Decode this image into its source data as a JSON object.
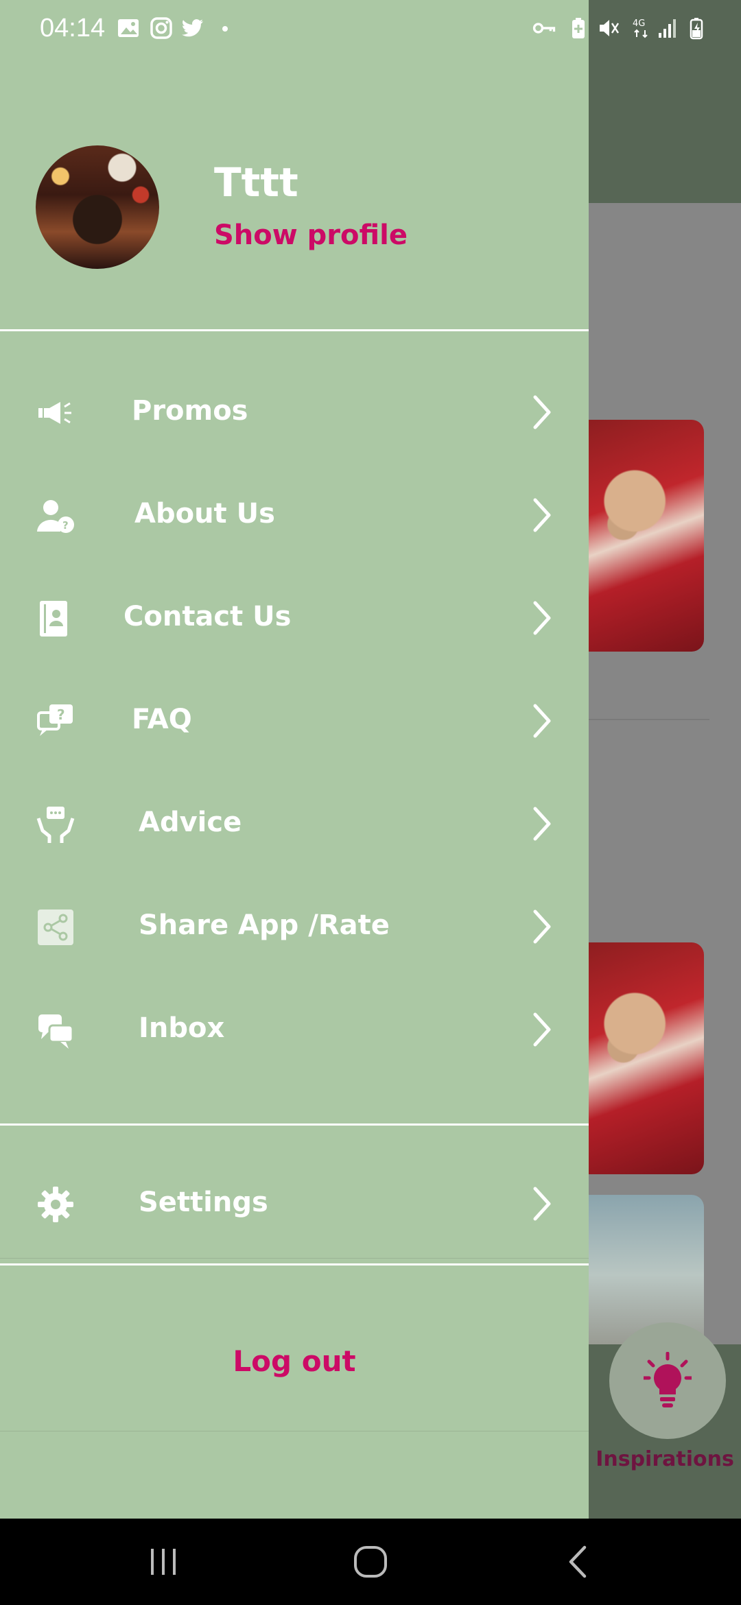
{
  "status_bar": {
    "time": "04:14",
    "left_icons": [
      "image-icon",
      "instagram-icon",
      "twitter-icon",
      "dot-icon"
    ],
    "right_icons": [
      "vpn-key-icon",
      "battery-saver-icon",
      "mute-icon",
      "network-4g-icon",
      "signal-icon",
      "battery-charging-icon"
    ],
    "network_label": "4G"
  },
  "drawer": {
    "profile": {
      "name": "Tttt",
      "show_profile": "Show profile"
    },
    "menu": [
      {
        "label": "Promos",
        "icon": "megaphone-icon"
      },
      {
        "label": "About Us",
        "icon": "user-question-icon"
      },
      {
        "label": "Contact Us",
        "icon": "contact-book-icon"
      },
      {
        "label": "FAQ",
        "icon": "faq-chat-icon"
      },
      {
        "label": "Advice",
        "icon": "hands-chat-icon"
      },
      {
        "label": "Share App /Rate",
        "icon": "share-icon"
      },
      {
        "label": "Inbox",
        "icon": "chat-bubbles-icon"
      }
    ],
    "settings": {
      "label": "Settings",
      "icon": "gear-icon"
    },
    "logout": "Log out"
  },
  "background": {
    "fab_label": "Inspirations",
    "fab_icon": "lightbulb-icon"
  },
  "nav_bar": {
    "buttons": [
      "recent-apps-icon",
      "home-icon",
      "back-icon"
    ]
  },
  "colors": {
    "drawer_bg": "#abc8a4",
    "accent": "#cc0a66",
    "header_dark": "#576655"
  }
}
